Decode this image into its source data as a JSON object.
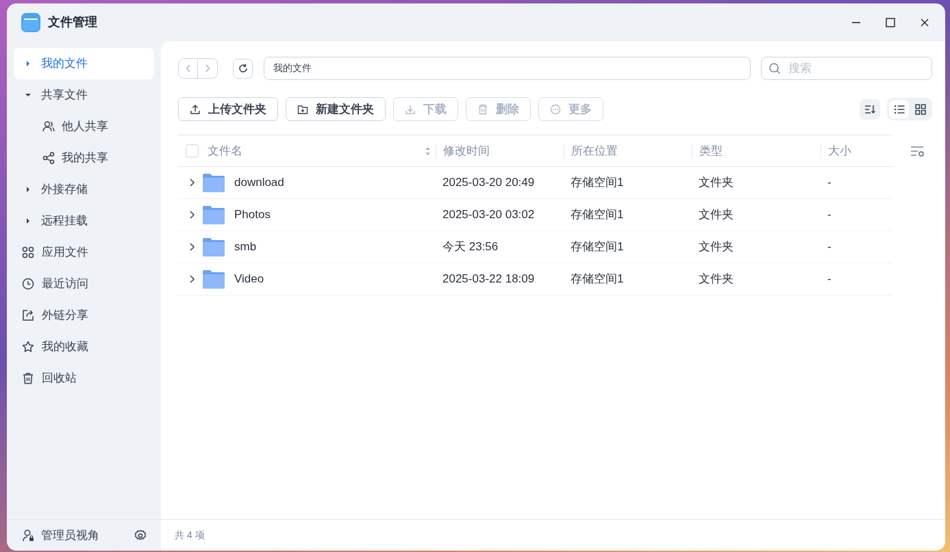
{
  "window": {
    "title": "文件管理"
  },
  "sidebar": {
    "items": [
      {
        "kind": "group",
        "label": "我的文件",
        "selected": true,
        "expanded": false
      },
      {
        "kind": "group",
        "label": "共享文件",
        "selected": false,
        "expanded": true,
        "children": [
          {
            "label": "他人共享",
            "selected": false
          },
          {
            "label": "我的共享",
            "selected": false
          }
        ]
      },
      {
        "kind": "group",
        "label": "外接存储",
        "selected": false,
        "expanded": false
      },
      {
        "kind": "group",
        "label": "远程挂载",
        "selected": false,
        "expanded": false
      },
      {
        "kind": "link",
        "label": "应用文件",
        "selected": false
      },
      {
        "kind": "link",
        "label": "最近访问",
        "selected": false
      },
      {
        "kind": "link",
        "label": "外链分享",
        "selected": false
      },
      {
        "kind": "link",
        "label": "我的收藏",
        "selected": false
      },
      {
        "kind": "link",
        "label": "回收站",
        "selected": false
      }
    ],
    "footer": {
      "label": "管理员视角"
    }
  },
  "path": {
    "value": "我的文件"
  },
  "search": {
    "placeholder": "搜索"
  },
  "actions": [
    {
      "label": "上传文件夹",
      "disabled": false
    },
    {
      "label": "新建文件夹",
      "disabled": false
    },
    {
      "label": "下载",
      "disabled": true
    },
    {
      "label": "删除",
      "disabled": true
    },
    {
      "label": "更多",
      "disabled": true
    }
  ],
  "view_modes": [
    {
      "selected": true
    },
    {
      "selected": false
    }
  ],
  "table": {
    "select_all": {
      "checked": false
    },
    "columns": [
      "文件名",
      "修改时间",
      "所在位置",
      "类型",
      "大小"
    ],
    "rows": [
      {
        "name": "download",
        "modified": "2025-03-20 20:49",
        "location": "存储空间1",
        "type": "文件夹",
        "size": "-",
        "checked": false
      },
      {
        "name": "Photos",
        "modified": "2025-03-20 03:02",
        "location": "存储空间1",
        "type": "文件夹",
        "size": "-",
        "checked": false
      },
      {
        "name": "smb",
        "modified": "今天 23:56",
        "location": "存储空间1",
        "type": "文件夹",
        "size": "-",
        "checked": false
      },
      {
        "name": "Video",
        "modified": "2025-03-22 18:09",
        "location": "存储空间1",
        "type": "文件夹",
        "size": "-",
        "checked": false
      }
    ]
  },
  "status_bar": {
    "count": "共 4 项"
  }
}
